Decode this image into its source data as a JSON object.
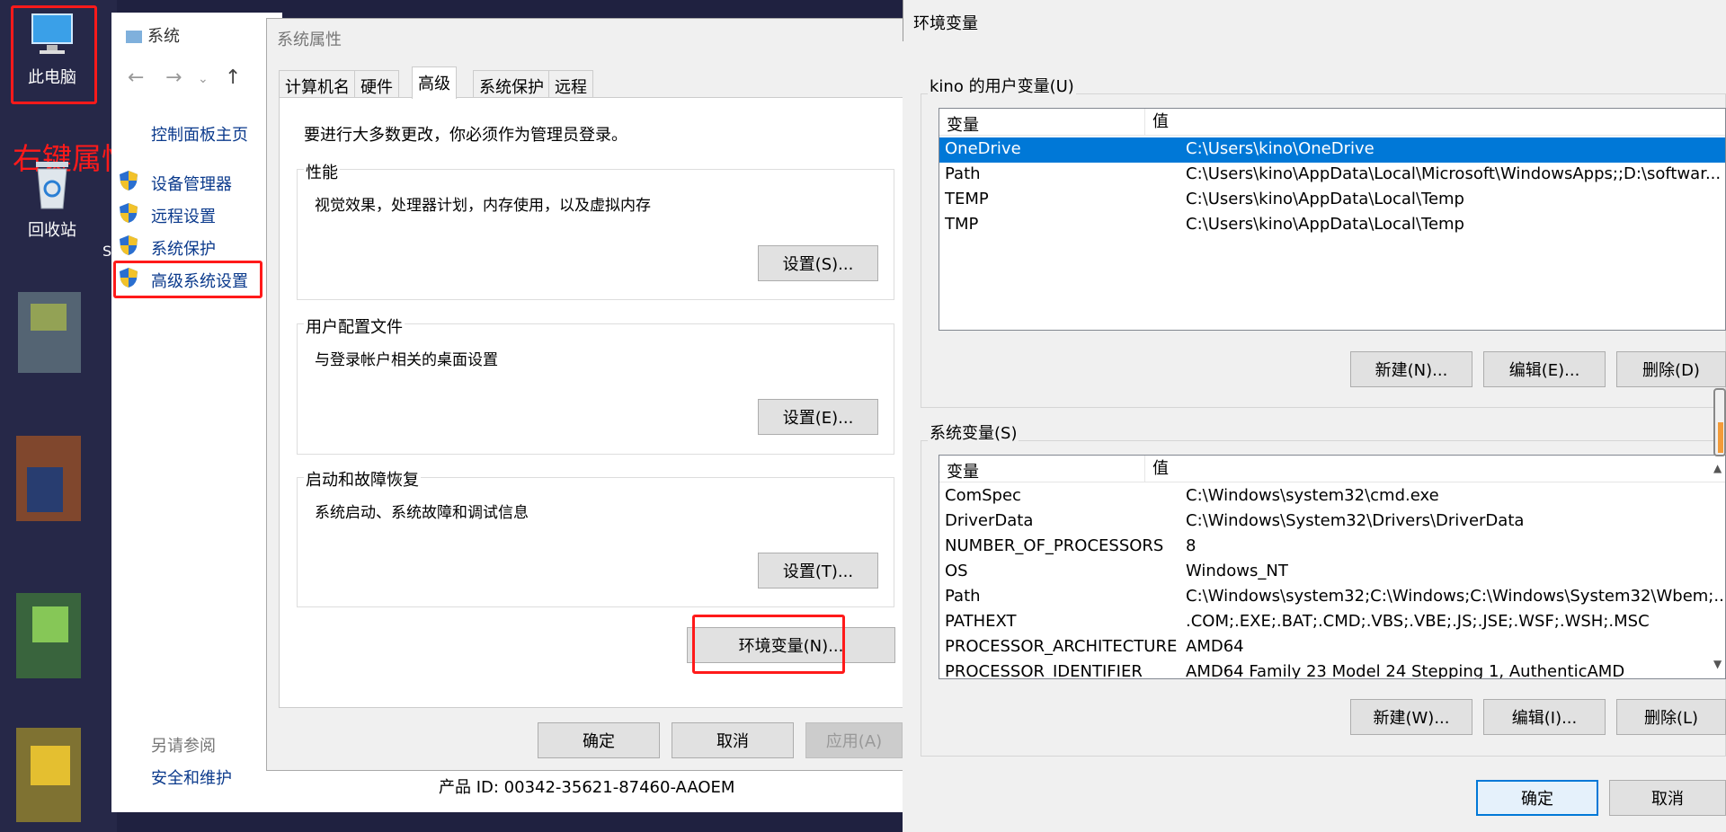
{
  "desktop": {
    "this_pc": "此电脑",
    "recycle_bin": "回收站",
    "annotation": "右键属性",
    "partial_letter": "S"
  },
  "system_window": {
    "title": "系统",
    "home_link": "控制面板主页",
    "links": [
      "设备管理器",
      "远程设置",
      "系统保护",
      "高级系统设置"
    ],
    "see_also": "另请参阅",
    "security_link": "安全和维护",
    "product_id": "产品 ID: 00342-35621-87460-AAOEM"
  },
  "system_properties": {
    "title": "系统属性",
    "tabs": [
      "计算机名",
      "硬件",
      "高级",
      "系统保护",
      "远程"
    ],
    "active_tab": "高级",
    "admin_note": "要进行大多数更改，你必须作为管理员登录。",
    "performance": {
      "label": "性能",
      "desc": "视觉效果，处理器计划，内存使用，以及虚拟内存",
      "button": "设置(S)..."
    },
    "user_profiles": {
      "label": "用户配置文件",
      "desc": "与登录帐户相关的桌面设置",
      "button": "设置(E)..."
    },
    "startup": {
      "label": "启动和故障恢复",
      "desc": "系统启动、系统故障和调试信息",
      "button": "设置(T)..."
    },
    "env_button": "环境变量(N)...",
    "ok": "确定",
    "cancel": "取消",
    "apply": "应用(A)"
  },
  "env_dialog": {
    "title": "环境变量",
    "user_vars_label": "kino 的用户变量(U)",
    "col_var": "变量",
    "col_val": "值",
    "user_vars": [
      {
        "name": "OneDrive",
        "value": "C:\\Users\\kino\\OneDrive"
      },
      {
        "name": "Path",
        "value": "C:\\Users\\kino\\AppData\\Local\\Microsoft\\WindowsApps;;D:\\softwar..."
      },
      {
        "name": "TEMP",
        "value": "C:\\Users\\kino\\AppData\\Local\\Temp"
      },
      {
        "name": "TMP",
        "value": "C:\\Users\\kino\\AppData\\Local\\Temp"
      }
    ],
    "user_buttons": [
      "新建(N)...",
      "编辑(E)...",
      "删除(D)"
    ],
    "sys_vars_label": "系统变量(S)",
    "sys_vars": [
      {
        "name": "ComSpec",
        "value": "C:\\Windows\\system32\\cmd.exe"
      },
      {
        "name": "DriverData",
        "value": "C:\\Windows\\System32\\Drivers\\DriverData"
      },
      {
        "name": "NUMBER_OF_PROCESSORS",
        "value": "8"
      },
      {
        "name": "OS",
        "value": "Windows_NT"
      },
      {
        "name": "Path",
        "value": "C:\\Windows\\system32;C:\\Windows;C:\\Windows\\System32\\Wbem;..."
      },
      {
        "name": "PATHEXT",
        "value": ".COM;.EXE;.BAT;.CMD;.VBS;.VBE;.JS;.JSE;.WSF;.WSH;.MSC"
      },
      {
        "name": "PROCESSOR_ARCHITECTURE",
        "value": "AMD64"
      },
      {
        "name": "PROCESSOR_IDENTIFIER",
        "value": "AMD64 Family 23 Model 24 Stepping 1, AuthenticAMD"
      }
    ],
    "sys_buttons": [
      "新建(W)...",
      "编辑(I)...",
      "删除(L)"
    ],
    "ok": "确定",
    "cancel": "取消"
  },
  "colors": {
    "highlight": "#0078d7",
    "annotation_red": "#ff1a1a"
  }
}
